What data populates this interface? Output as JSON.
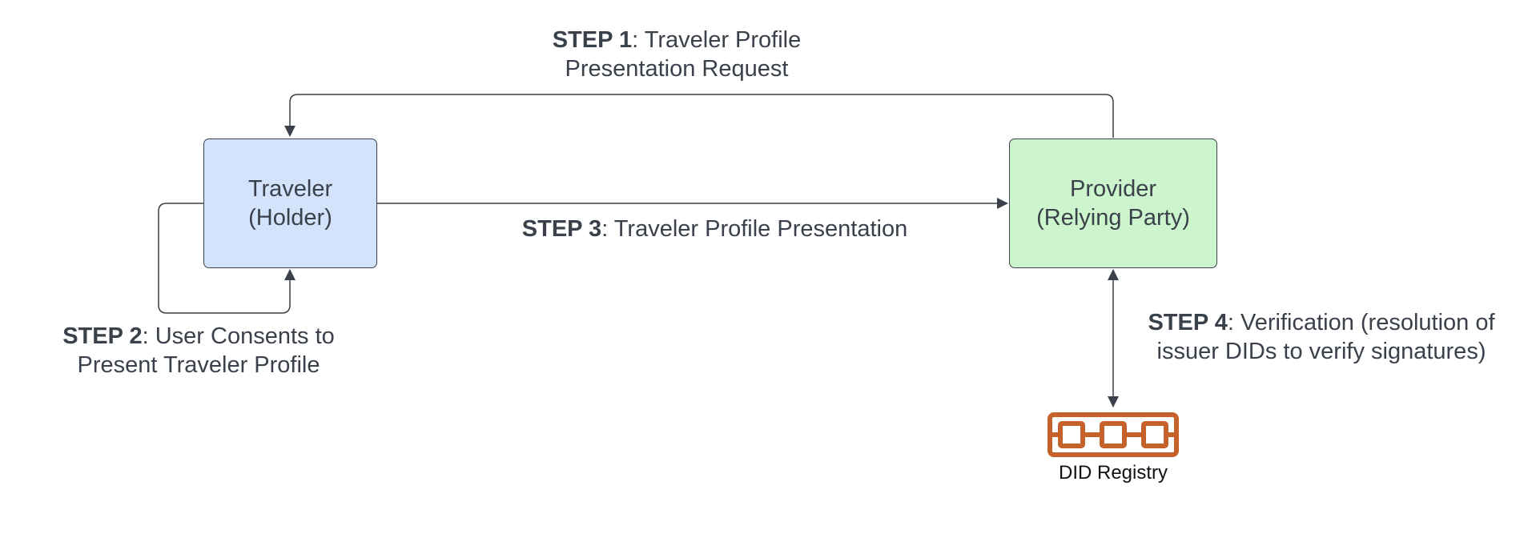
{
  "nodes": {
    "traveler": {
      "line1": "Traveler",
      "line2": "(Holder)"
    },
    "provider": {
      "line1": "Provider",
      "line2": "(Relying Party)"
    },
    "registry": {
      "label": "DID Registry",
      "icon": "chain-link-icon",
      "color": "#c5612a"
    }
  },
  "steps": {
    "step1": {
      "bold": "STEP 1",
      "rest_line1": ": Traveler Profile",
      "line2": "Presentation Request"
    },
    "step2": {
      "bold": "STEP 2",
      "rest_line1": ": User Consents to",
      "line2": "Present Traveler Profile"
    },
    "step3": {
      "bold": "STEP 3",
      "rest_line1": ": Traveler Profile Presentation"
    },
    "step4": {
      "bold": "STEP 4",
      "rest_line1": ": Verification (resolution of",
      "line2": "issuer DIDs to verify signatures)"
    }
  },
  "colors": {
    "traveler_fill": "#d3e3fb",
    "provider_fill": "#cdf5cd",
    "stroke": "#3a414a"
  }
}
